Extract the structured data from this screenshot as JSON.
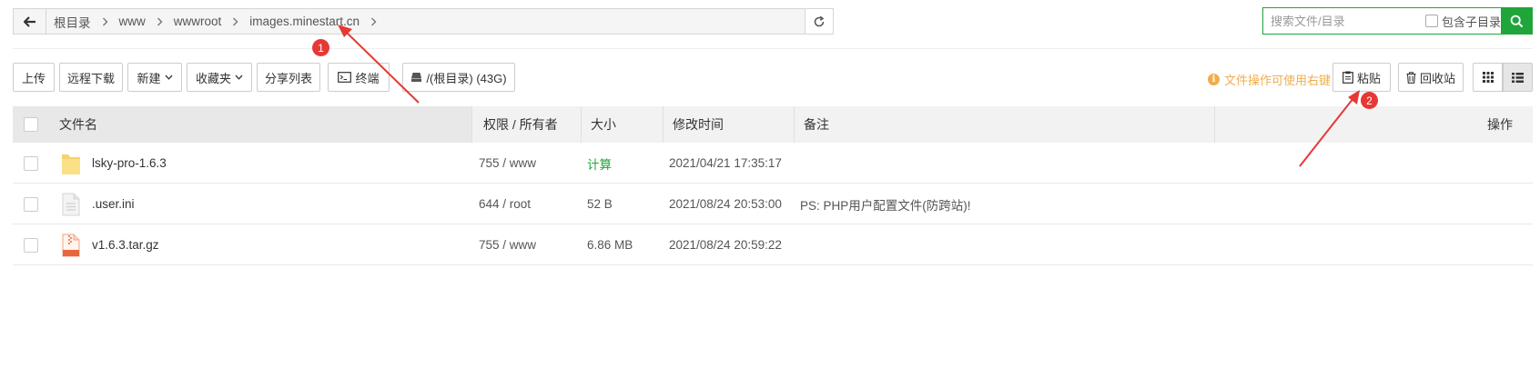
{
  "pathbar": {
    "back_icon": "arrow-left-icon",
    "crumbs": [
      "根目录",
      "www",
      "wwwroot",
      "images.minestart.cn"
    ],
    "refresh_icon": "refresh-icon"
  },
  "search": {
    "placeholder": "搜索文件/目录",
    "subdir_label": "包含子目录",
    "button_icon": "search-icon"
  },
  "toolbar": {
    "upload": "上传",
    "remote_download": "远程下载",
    "new": "新建",
    "favorites": "收藏夹",
    "share_list": "分享列表",
    "terminal": "终端",
    "disk": "/(根目录) (43G)",
    "tip": "文件操作可使用右键",
    "paste": "粘贴",
    "recycle_bin": "回收站"
  },
  "table": {
    "headers": {
      "name": "文件名",
      "perm_owner": "权限 / 所有者",
      "size": "大小",
      "mtime": "修改时间",
      "remark": "备注",
      "action": "操作"
    },
    "rows": [
      {
        "icon": "folder-icon",
        "name": "lsky-pro-1.6.3",
        "perm": "755 / www",
        "size": "计算",
        "mtime": "2021/04/21 17:35:17",
        "remark": ""
      },
      {
        "icon": "file-icon",
        "name": ".user.ini",
        "perm": "644 / root",
        "size": "52 B",
        "mtime": "2021/08/24 20:53:00",
        "remark": "PS: PHP用户配置文件(防跨站)!"
      },
      {
        "icon": "archive-icon",
        "name": "v1.6.3.tar.gz",
        "perm": "755 / www",
        "size": "6.86 MB",
        "mtime": "2021/08/24 20:59:22",
        "remark": ""
      }
    ]
  },
  "annotations": {
    "badge_1": "1",
    "badge_2": "2"
  },
  "colors": {
    "accent_green": "#20a53a",
    "tip_orange": "#f0ad4e",
    "annotation_red": "#e53935"
  }
}
